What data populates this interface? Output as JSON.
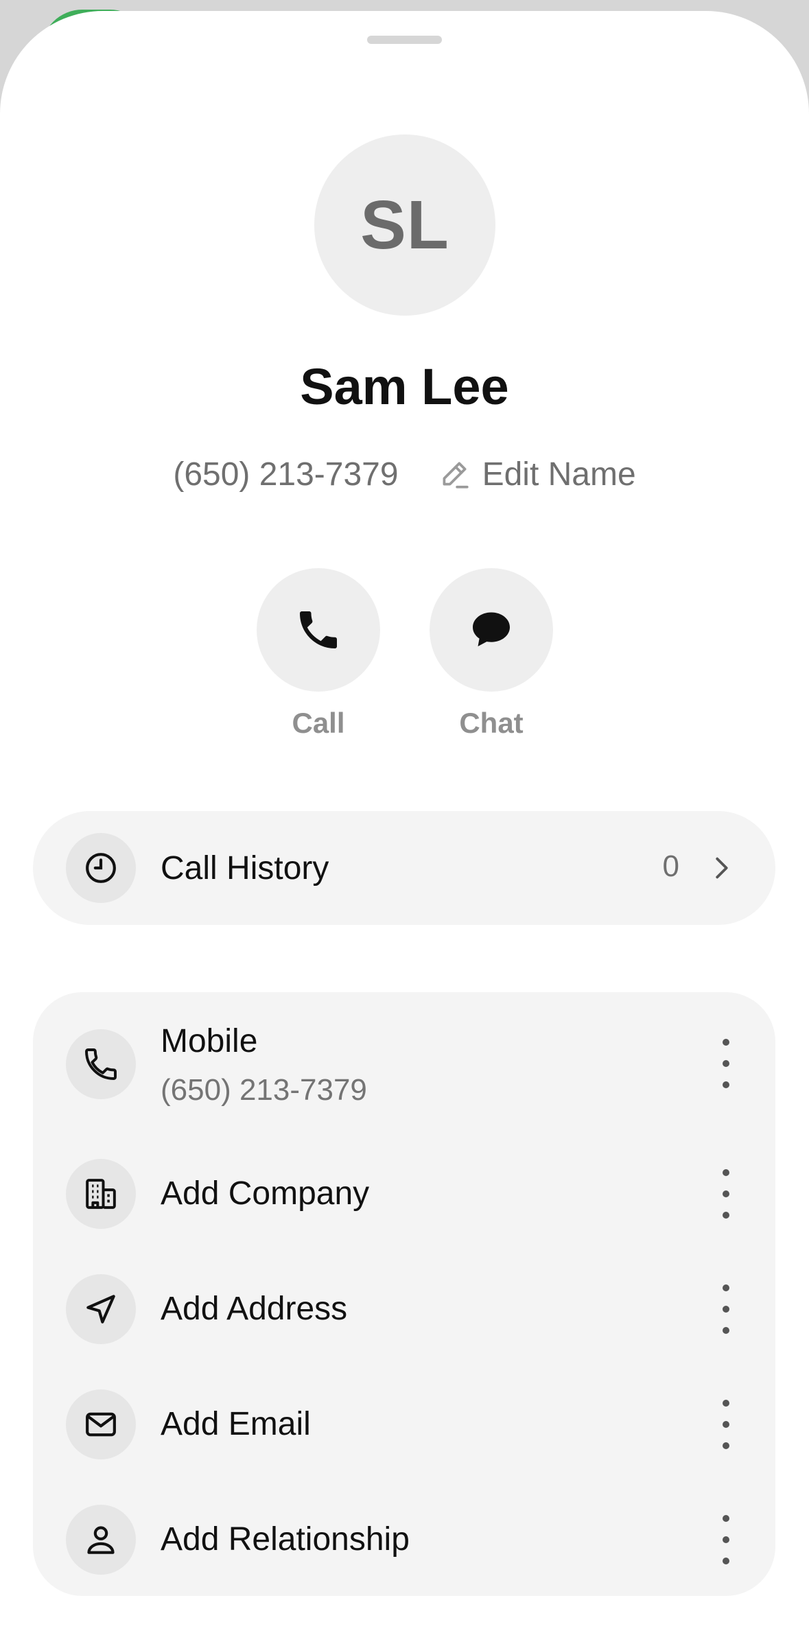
{
  "contact": {
    "initials": "SL",
    "name": "Sam Lee",
    "phone": "(650) 213-7379",
    "edit_label": "Edit Name"
  },
  "actions": {
    "call_label": "Call",
    "chat_label": "Chat"
  },
  "history": {
    "label": "Call History",
    "count": "0",
    "icon": "clock-icon"
  },
  "details": {
    "items": [
      {
        "label": "Mobile",
        "sub": "(650) 213-7379",
        "icon": "phone-icon"
      },
      {
        "label": "Add Company",
        "icon": "building-icon"
      },
      {
        "label": "Add Address",
        "icon": "location-arrow-icon"
      },
      {
        "label": "Add Email",
        "icon": "mail-icon"
      },
      {
        "label": "Add Relationship",
        "icon": "person-icon"
      }
    ]
  },
  "colors": {
    "sheet_background": "#ffffff",
    "card_background": "#f4f4f4",
    "icon_circle": "#e6e6e6",
    "primary_text": "#111111",
    "secondary_text": "#6f6f6f",
    "peek_green": "#3fae5a"
  }
}
